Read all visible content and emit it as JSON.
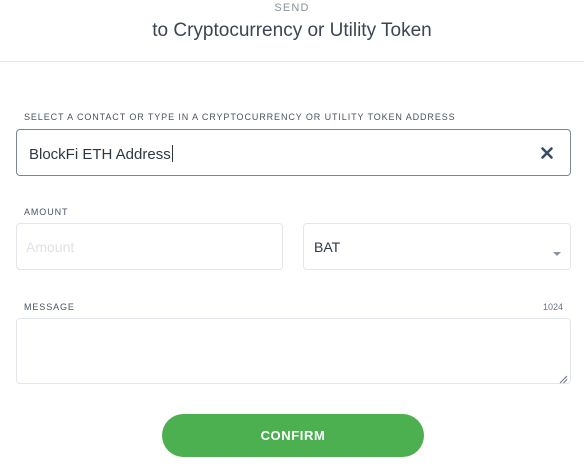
{
  "header": {
    "eyebrow": "SEND",
    "title": "to Cryptocurrency or Utility Token"
  },
  "recipient": {
    "label": "SELECT A CONTACT OR TYPE IN A CRYPTOCURRENCY OR UTILITY TOKEN ADDRESS",
    "value": "BlockFi ETH Address",
    "clear_icon": "close-icon"
  },
  "amount": {
    "label": "AMOUNT",
    "placeholder": "Amount",
    "value": ""
  },
  "currency": {
    "selected": "BAT",
    "dropdown_icon": "caret-down-icon"
  },
  "message": {
    "label": "MESSAGE",
    "char_limit": "1024",
    "value": ""
  },
  "confirm": {
    "label": "CONFIRM"
  },
  "colors": {
    "accent": "#4caf50",
    "text": "#333d4a",
    "border": "#e3e6ea",
    "active_border": "#7c8592"
  }
}
